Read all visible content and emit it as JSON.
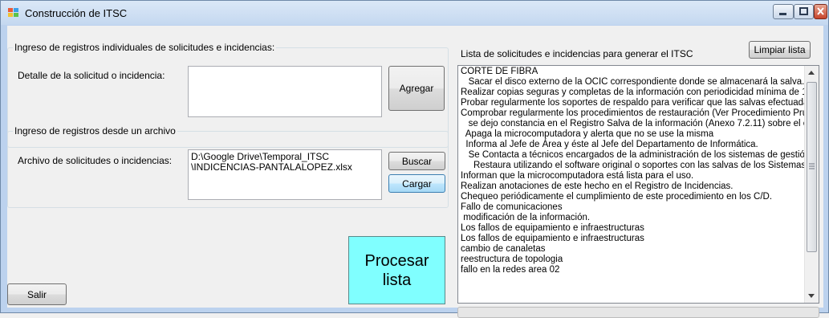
{
  "window": {
    "title": "Construcción de ITSC"
  },
  "group_individual": {
    "title": "Ingreso de registros individuales de solicitudes e incidencias:",
    "detail_label": "Detalle de la solicitud o incidencia:",
    "detail_value": "",
    "add_button": "Agregar"
  },
  "group_file": {
    "title": "Ingreso de registros desde un archivo",
    "file_label": "Archivo de solicitudes o incidencias:",
    "file_path_line1": "D:\\Google Drive\\Temporal_ITSC",
    "file_path_line2": "\\INDICENCIAS-PANTALALOPEZ.xlsx",
    "search_button": "Buscar",
    "load_button": "Cargar"
  },
  "process_button": {
    "line1": "Procesar",
    "line2": "lista"
  },
  "exit_button": "Salir",
  "list_panel": {
    "title": "Lista de solicitudes e incidencias para generar el ITSC",
    "clear_button": "Limpiar lista",
    "items": [
      "CORTE DE FIBRA",
      "   Sacar el disco externo de la OCIC correspondiente donde se almacenará la salva.",
      "Realizar copias seguras y completas de la información con periodicidad mínima de 1",
      "Probar regularmente los soportes de respaldo para verificar que las salvas efectuada",
      "Comprobar regularmente los procedimientos de restauración (Ver Procedimiento Prue",
      "   se dejo constancia en el Registro Salva de la información (Anexo 7.2.11) sobre el é",
      "  Apaga la microcomputadora y alerta que no se use la misma",
      "  Informa al Jefe de Área y éste al Jefe del Departamento de Informática.",
      "   Se Contacta a técnicos encargados de la administración de los sistemas de gestión",
      "     Restaura utilizando el software original o soportes con las salvas de los Sistemas C",
      "Informan que la microcomputadora está lista para el uso.",
      "Realizan anotaciones de este hecho en el Registro de Incidencias.",
      "Chequeo periódicamente el cumplimiento de este procedimiento en los C/D.",
      "Fallo de comunicaciones",
      " modificación de la información.",
      "Los fallos de equipamiento e infraestructuras",
      "Los fallos de equipamiento e infraestructuras",
      "cambio de canaletas",
      "reestructura de topologia",
      "fallo en la redes area 02"
    ]
  },
  "colors": {
    "process_button_bg": "#80ffff",
    "close_button": "#c7432a"
  }
}
